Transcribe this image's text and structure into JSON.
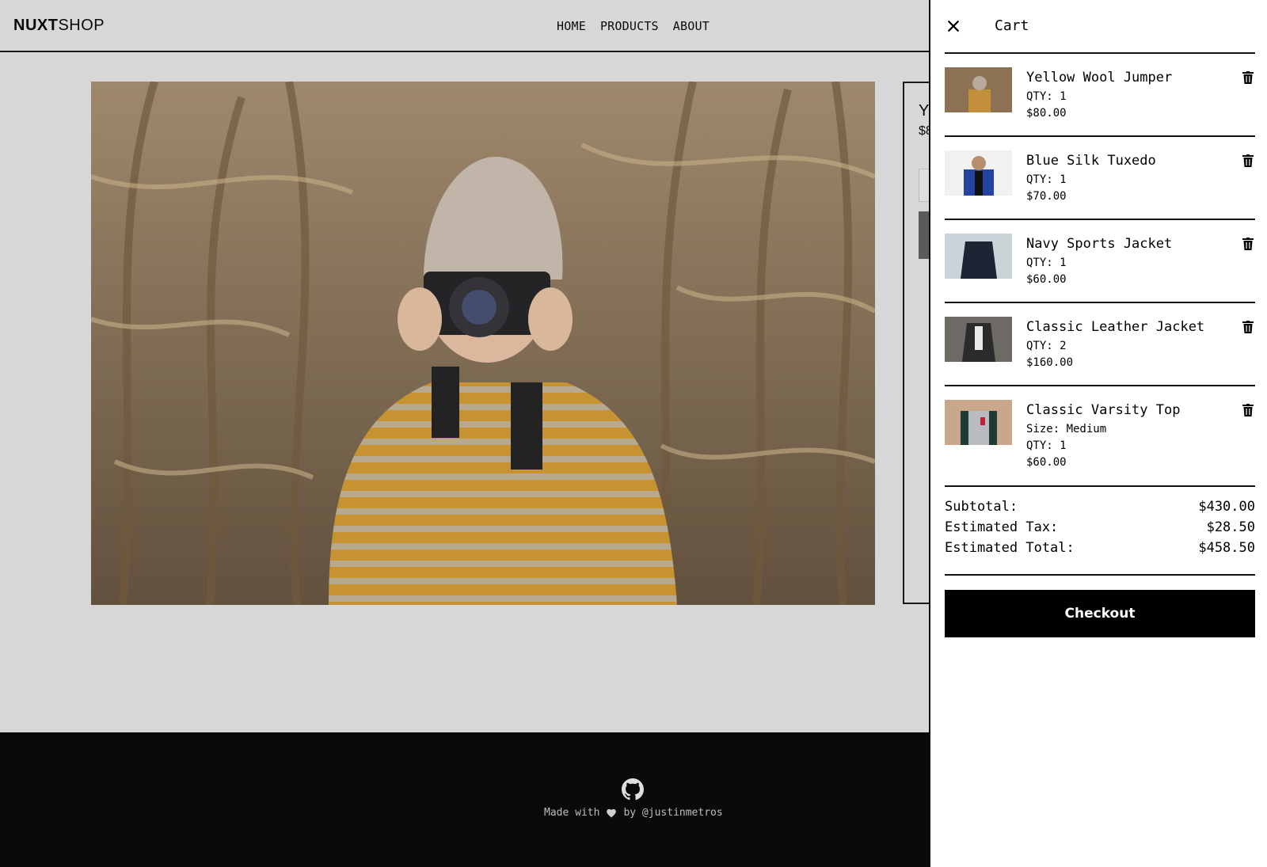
{
  "header": {
    "logo_bold": "NUXT",
    "logo_light": "SHOP",
    "nav": [
      "HOME",
      "PRODUCTS",
      "ABOUT"
    ]
  },
  "product_card": {
    "title_partial": "Y",
    "price_partial": "$8"
  },
  "footer": {
    "made_with": "Made with",
    "by": "by @justinmetros"
  },
  "cart": {
    "title": "Cart",
    "items": [
      {
        "name": "Yellow Wool Jumper",
        "qty": "QTY: 1",
        "price": "$80.00"
      },
      {
        "name": "Blue Silk Tuxedo",
        "qty": "QTY: 1",
        "price": "$70.00"
      },
      {
        "name": "Navy Sports Jacket",
        "qty": "QTY: 1",
        "price": "$60.00"
      },
      {
        "name": "Classic Leather Jacket",
        "qty": "QTY: 2",
        "price": "$160.00"
      },
      {
        "name": "Classic Varsity Top",
        "size": "Size: Medium",
        "qty": "QTY: 1",
        "price": "$60.00"
      }
    ],
    "subtotal_label": "Subtotal:",
    "subtotal": "$430.00",
    "tax_label": "Estimated Tax:",
    "tax": "$28.50",
    "total_label": "Estimated Total:",
    "total": "$458.50",
    "checkout_label": "Checkout"
  }
}
